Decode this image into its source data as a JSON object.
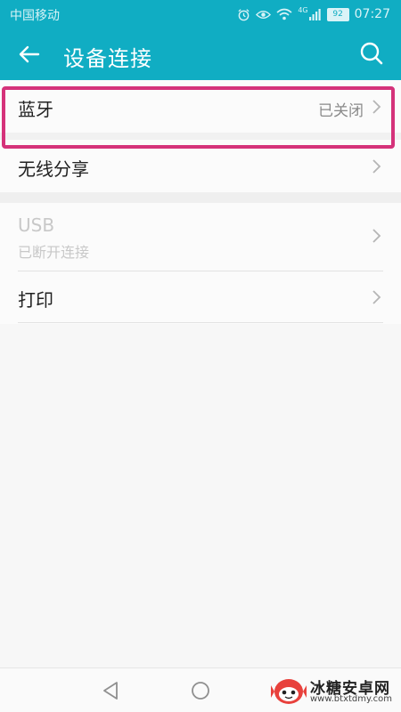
{
  "status_bar": {
    "carrier": "中国移动",
    "network": "4G",
    "battery": "92",
    "time": "07:27",
    "icons": [
      "alarm-icon",
      "eye-icon",
      "wifi-icon",
      "signal-icon",
      "battery-icon"
    ]
  },
  "app_bar": {
    "title": "设备连接",
    "back_icon": "arrow-left-icon",
    "search_icon": "search-icon",
    "background": "#10adc3"
  },
  "settings": {
    "bluetooth": {
      "title": "蓝牙",
      "value": "已关闭"
    },
    "wireless_share": {
      "title": "无线分享"
    },
    "usb": {
      "title": "USB",
      "subtitle": "已断开连接"
    },
    "print": {
      "title": "打印"
    }
  },
  "highlight_color": "#d5327a",
  "nav_bar": {
    "icons": [
      "back-triangle-icon",
      "home-circle-icon"
    ]
  },
  "watermark": {
    "brand": "冰糖安卓网",
    "url": "www.btxtdmy.com"
  }
}
